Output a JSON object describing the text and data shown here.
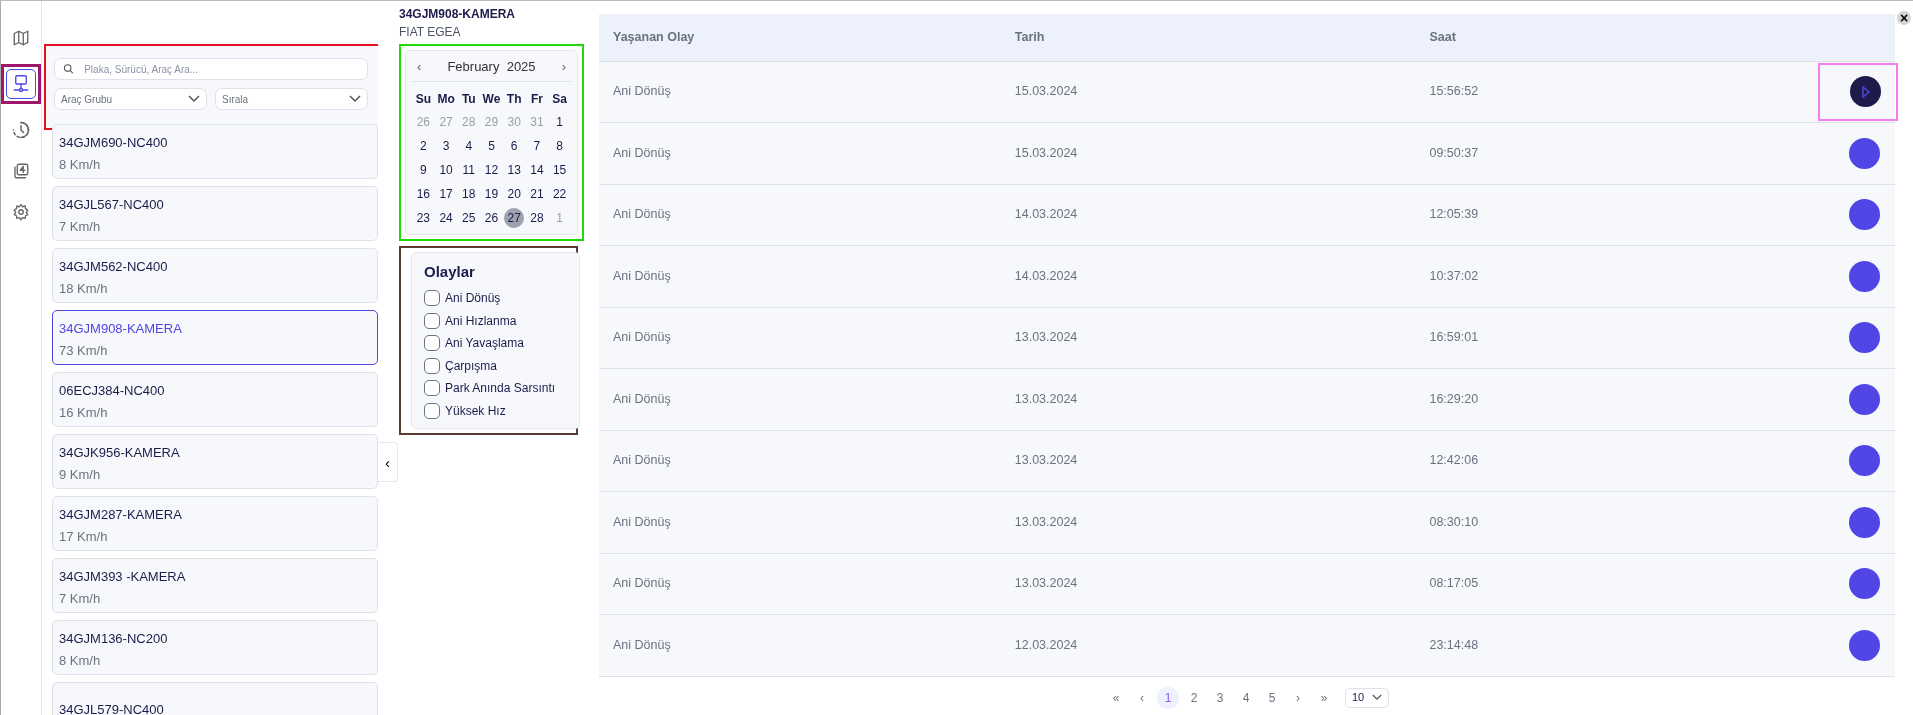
{
  "rail": [
    {
      "selected": false
    },
    {
      "selected": true
    },
    {
      "selected": false
    },
    {
      "selected": false
    },
    {
      "selected": false
    }
  ],
  "filters": {
    "search_placeholder": "Plaka, Sürücü, Araç Ara...",
    "group_select": "Araç Grubu",
    "sort_select": "Sırala"
  },
  "vehicles": [
    {
      "plate": "34GJM690-NC400",
      "speed": "8 Km/h",
      "selected": false
    },
    {
      "plate": "34GJL567-NC400",
      "speed": "7 Km/h",
      "selected": false
    },
    {
      "plate": "34GJM562-NC400",
      "speed": "18 Km/h",
      "selected": false
    },
    {
      "plate": "34GJM908-KAMERA",
      "speed": "73 Km/h",
      "selected": true
    },
    {
      "plate": "06ECJ384-NC400",
      "speed": "16 Km/h",
      "selected": false
    },
    {
      "plate": "34GJK956-KAMERA",
      "speed": "9 Km/h",
      "selected": false
    },
    {
      "plate": "34GJM287-KAMERA",
      "speed": "17 Km/h",
      "selected": false
    },
    {
      "plate": "34GJM393 -KAMERA",
      "speed": "7 Km/h",
      "selected": false
    },
    {
      "plate": "34GJM136-NC200",
      "speed": "8 Km/h",
      "selected": false
    },
    {
      "plate": "34GJL579-NC400",
      "selected": false
    }
  ],
  "collapse_button": "‹",
  "vehicle_title": "34GJM908-KAMERA",
  "vehicle_model": "FIAT EGEA",
  "calendar": {
    "prev": "‹",
    "next": "›",
    "month": "February",
    "year": "2025",
    "weekdays": [
      "Su",
      "Mo",
      "Tu",
      "We",
      "Th",
      "Fr",
      "Sa"
    ],
    "days": [
      {
        "label": "26",
        "muted": true,
        "selected": false
      },
      {
        "label": "27",
        "muted": true,
        "selected": false
      },
      {
        "label": "28",
        "muted": true,
        "selected": false
      },
      {
        "label": "29",
        "muted": true,
        "selected": false
      },
      {
        "label": "30",
        "muted": true,
        "selected": false
      },
      {
        "label": "31",
        "muted": true,
        "selected": false
      },
      {
        "label": "1",
        "muted": false,
        "selected": false
      },
      {
        "label": "2",
        "muted": false,
        "selected": false
      },
      {
        "label": "3",
        "muted": false,
        "selected": false
      },
      {
        "label": "4",
        "muted": false,
        "selected": false
      },
      {
        "label": "5",
        "muted": false,
        "selected": false
      },
      {
        "label": "6",
        "muted": false,
        "selected": false
      },
      {
        "label": "7",
        "muted": false,
        "selected": false
      },
      {
        "label": "8",
        "muted": false,
        "selected": false
      },
      {
        "label": "9",
        "muted": false,
        "selected": false
      },
      {
        "label": "10",
        "muted": false,
        "selected": false
      },
      {
        "label": "11",
        "muted": false,
        "selected": false
      },
      {
        "label": "12",
        "muted": false,
        "selected": false
      },
      {
        "label": "13",
        "muted": false,
        "selected": false
      },
      {
        "label": "14",
        "muted": false,
        "selected": false
      },
      {
        "label": "15",
        "muted": false,
        "selected": false
      },
      {
        "label": "16",
        "muted": false,
        "selected": false
      },
      {
        "label": "17",
        "muted": false,
        "selected": false
      },
      {
        "label": "18",
        "muted": false,
        "selected": false
      },
      {
        "label": "19",
        "muted": false,
        "selected": false
      },
      {
        "label": "20",
        "muted": false,
        "selected": false
      },
      {
        "label": "21",
        "muted": false,
        "selected": false
      },
      {
        "label": "22",
        "muted": false,
        "selected": false
      },
      {
        "label": "23",
        "muted": false,
        "selected": false
      },
      {
        "label": "24",
        "muted": false,
        "selected": false
      },
      {
        "label": "25",
        "muted": false,
        "selected": false
      },
      {
        "label": "26",
        "muted": false,
        "selected": false
      },
      {
        "label": "27",
        "muted": false,
        "selected": true
      },
      {
        "label": "28",
        "muted": false,
        "selected": false
      },
      {
        "label": "1",
        "muted": true,
        "selected": false
      }
    ]
  },
  "events": {
    "title": "Olaylar",
    "items": [
      {
        "label": "Ani Dönüş",
        "checked": false
      },
      {
        "label": "Ani Hızlanma",
        "checked": false
      },
      {
        "label": "Ani Yavaşlama",
        "checked": false
      },
      {
        "label": "Çarpışma",
        "checked": false
      },
      {
        "label": "Park Anında Sarsıntı",
        "checked": false
      },
      {
        "label": "Yüksek Hız",
        "checked": false
      }
    ]
  },
  "table": {
    "columns": [
      "Yaşanan Olay",
      "Tarih",
      "Saat"
    ],
    "rows": [
      {
        "event": "Ani Dönüş",
        "date": "15.03.2024",
        "time": "15:56:52",
        "selected": true
      },
      {
        "event": "Ani Dönüş",
        "date": "15.03.2024",
        "time": "09:50:37",
        "selected": false
      },
      {
        "event": "Ani Dönüş",
        "date": "14.03.2024",
        "time": "12:05:39",
        "selected": false
      },
      {
        "event": "Ani Dönüş",
        "date": "14.03.2024",
        "time": "10:37:02",
        "selected": false
      },
      {
        "event": "Ani Dönüş",
        "date": "13.03.2024",
        "time": "16:59:01",
        "selected": false
      },
      {
        "event": "Ani Dönüş",
        "date": "13.03.2024",
        "time": "16:29:20",
        "selected": false
      },
      {
        "event": "Ani Dönüş",
        "date": "13.03.2024",
        "time": "12:42:06",
        "selected": false
      },
      {
        "event": "Ani Dönüş",
        "date": "13.03.2024",
        "time": "08:30:10",
        "selected": false
      },
      {
        "event": "Ani Dönüş",
        "date": "13.03.2024",
        "time": "08:17:05",
        "selected": false
      },
      {
        "event": "Ani Dönüş",
        "date": "12.03.2024",
        "time": "23:14:48",
        "selected": false
      }
    ]
  },
  "pagination": {
    "first": "«",
    "prev": "‹",
    "pages": [
      {
        "label": "1",
        "selected": true
      },
      {
        "label": "2",
        "selected": false
      },
      {
        "label": "3",
        "selected": false
      },
      {
        "label": "4",
        "selected": false
      },
      {
        "label": "5",
        "selected": false
      }
    ],
    "next": "›",
    "last": "»",
    "page_size": "10"
  },
  "close_button": "×"
}
